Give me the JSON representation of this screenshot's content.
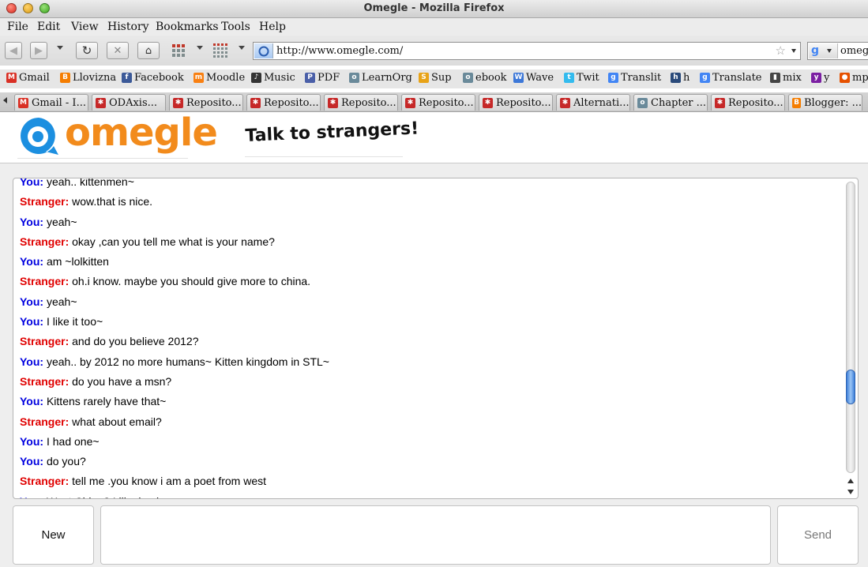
{
  "window": {
    "title": "Omegle - Mozilla Firefox"
  },
  "menu": [
    "File",
    "Edit",
    "View",
    "History",
    "Bookmarks",
    "Tools",
    "Help"
  ],
  "address_bar": {
    "url": "http://www.omegle.com/"
  },
  "search_bar": {
    "value": "omegl"
  },
  "bookmarks": [
    {
      "label": "Gmail",
      "icon": "gmail-icon",
      "color": "#d93025",
      "glyph": "M"
    },
    {
      "label": "Llovizna",
      "icon": "blogger-icon",
      "color": "#f57d00",
      "glyph": "B"
    },
    {
      "label": "Facebook",
      "icon": "facebook-icon",
      "color": "#3b5998",
      "glyph": "f"
    },
    {
      "label": "Moodle",
      "icon": "moodle-icon",
      "color": "#f98012",
      "glyph": "m"
    },
    {
      "label": "Music",
      "icon": "music-icon",
      "color": "#333333",
      "glyph": "♪"
    },
    {
      "label": "PDF",
      "icon": "pdf-icon",
      "color": "#4a5fa8",
      "glyph": "P"
    },
    {
      "label": "LearnOrg",
      "icon": "globe-icon",
      "color": "#6a8a9a",
      "glyph": "o"
    },
    {
      "label": "Sup",
      "icon": "sup-icon",
      "color": "#e8a317",
      "glyph": "S"
    },
    {
      "label": "ebook",
      "icon": "globe-icon",
      "color": "#6a8a9a",
      "glyph": "o"
    },
    {
      "label": "Wave",
      "icon": "wave-icon",
      "color": "#3d78d8",
      "glyph": "W"
    },
    {
      "label": "Twit",
      "icon": "twitter-icon",
      "color": "#33bbee",
      "glyph": "t"
    },
    {
      "label": "Translit",
      "icon": "google-icon",
      "color": "#4285f4",
      "glyph": "g"
    },
    {
      "label": "h",
      "icon": "h-icon",
      "color": "#2a4a7a",
      "glyph": "h"
    },
    {
      "label": "Translate",
      "icon": "google-icon",
      "color": "#4285f4",
      "glyph": "g"
    },
    {
      "label": "mix",
      "icon": "mix-icon",
      "color": "#444444",
      "glyph": "▮"
    },
    {
      "label": "y",
      "icon": "yahoo-icon",
      "color": "#7b1fa2",
      "glyph": "y"
    },
    {
      "label": "mp",
      "icon": "mp-icon",
      "color": "#e65100",
      "glyph": "●"
    }
  ],
  "tabs": [
    {
      "label": "Gmail - I...",
      "icon": "gmail-icon",
      "color": "#d93025",
      "glyph": "M"
    },
    {
      "label": "ODAxis...",
      "icon": "paw-icon",
      "color": "#c62828",
      "glyph": "✱"
    },
    {
      "label": "Reposito...",
      "icon": "paw-icon",
      "color": "#c62828",
      "glyph": "✱"
    },
    {
      "label": "Reposito...",
      "icon": "paw-icon",
      "color": "#c62828",
      "glyph": "✱"
    },
    {
      "label": "Reposito...",
      "icon": "paw-icon",
      "color": "#c62828",
      "glyph": "✱"
    },
    {
      "label": "Reposito...",
      "icon": "paw-icon",
      "color": "#c62828",
      "glyph": "✱"
    },
    {
      "label": "Reposito...",
      "icon": "paw-icon",
      "color": "#c62828",
      "glyph": "✱"
    },
    {
      "label": "Alternati...",
      "icon": "paw-icon",
      "color": "#c62828",
      "glyph": "✱"
    },
    {
      "label": "Chapter ...",
      "icon": "globe-icon",
      "color": "#6a8a9a",
      "glyph": "o"
    },
    {
      "label": "Reposito...",
      "icon": "paw-icon",
      "color": "#c62828",
      "glyph": "✱"
    },
    {
      "label": "Blogger: ...",
      "icon": "blogger-icon",
      "color": "#f57d00",
      "glyph": "B"
    }
  ],
  "page": {
    "logo_text": "omegle",
    "tagline": "Talk to strangers!",
    "colors": {
      "logo": "#f28b1c",
      "you": "#0000e0",
      "stranger": "#e00000",
      "logo_bubble": "#1c8fe0"
    }
  },
  "chat": {
    "you_label": "You:",
    "stranger_label": "Stranger:",
    "messages": [
      {
        "from": "you",
        "text": "yeah.. kittenmen~"
      },
      {
        "from": "stranger",
        "text": "wow.that is nice."
      },
      {
        "from": "you",
        "text": "yeah~"
      },
      {
        "from": "stranger",
        "text": "okay ,can you tell me what is your name?"
      },
      {
        "from": "you",
        "text": "am ~lolkitten"
      },
      {
        "from": "stranger",
        "text": "oh.i know. maybe you should give more to china."
      },
      {
        "from": "you",
        "text": "yeah~"
      },
      {
        "from": "you",
        "text": "I like it too~"
      },
      {
        "from": "stranger",
        "text": "and do you believe 2012?"
      },
      {
        "from": "you",
        "text": "yeah.. by 2012 no more humans~ Kitten kingdom in STL~"
      },
      {
        "from": "stranger",
        "text": "do you have a msn?"
      },
      {
        "from": "you",
        "text": "Kittens rarely have that~"
      },
      {
        "from": "stranger",
        "text": "what about email?"
      },
      {
        "from": "you",
        "text": "I had one~"
      },
      {
        "from": "you",
        "text": "do you?"
      },
      {
        "from": "stranger",
        "text": "tell me .you know i am a poet from west"
      },
      {
        "from": "you",
        "text": "West China? I like lambs~"
      }
    ]
  },
  "controls": {
    "new_label": "New",
    "send_label": "Send",
    "message_value": ""
  }
}
